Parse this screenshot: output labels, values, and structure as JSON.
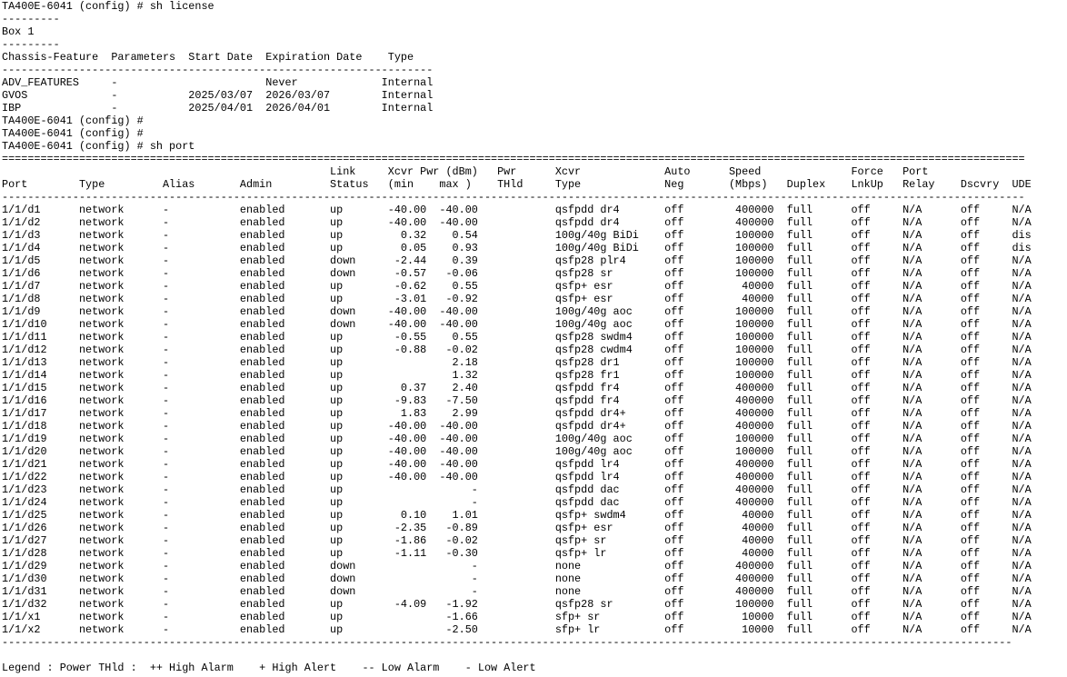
{
  "terminal": {
    "lines": [
      "TA400E-6041 (config) # sh license",
      "---------",
      "Box 1",
      "---------",
      "Chassis-Feature  Parameters  Start Date  Expiration Date    Type",
      "-------------------------------------------------------------------",
      "ADV_FEATURES     -                       Never             Internal",
      "GVOS             -           2025/03/07  2026/03/07        Internal",
      "IBP              -           2025/04/01  2026/04/01        Internal",
      "TA400E-6041 (config) #",
      "TA400E-6041 (config) #",
      "TA400E-6041 (config) # sh port",
      "===============================================================================================================================================================",
      "                                                   Link     Xcvr Pwr (dBm)   Pwr      Xcvr             Auto      Speed              Force   Port",
      "Port        Type         Alias       Admin         Status   (min    max )    THld     Type             Neg       (Mbps)   Duplex    LnkUp   Relay    Dscvry  UDE",
      "---------------------------------------------------------------------------------------------------------------------------------------------------------------",
      "1/1/d1      network      -           enabled       up       -40.00  -40.00            qsfpdd dr4       off        400000  full      off     N/A      off     N/A",
      "1/1/d2      network      -           enabled       up       -40.00  -40.00            qsfpdd dr4       off        400000  full      off     N/A      off     N/A",
      "1/1/d3      network      -           enabled       up         0.32    0.54            100g/40g BiDi    off        100000  full      off     N/A      off     dis",
      "1/1/d4      network      -           enabled       up         0.05    0.93            100g/40g BiDi    off        100000  full      off     N/A      off     dis",
      "1/1/d5      network      -           enabled       down      -2.44    0.39            qsfp28 plr4      off        100000  full      off     N/A      off     N/A",
      "1/1/d6      network      -           enabled       down      -0.57   -0.06            qsfp28 sr        off        100000  full      off     N/A      off     N/A",
      "1/1/d7      network      -           enabled       up        -0.62    0.55            qsfp+ esr        off         40000  full      off     N/A      off     N/A",
      "1/1/d8      network      -           enabled       up        -3.01   -0.92            qsfp+ esr        off         40000  full      off     N/A      off     N/A",
      "1/1/d9      network      -           enabled       down     -40.00  -40.00            100g/40g aoc     off        100000  full      off     N/A      off     N/A",
      "1/1/d10     network      -           enabled       down     -40.00  -40.00            100g/40g aoc     off        100000  full      off     N/A      off     N/A",
      "1/1/d11     network      -           enabled       up        -0.55    0.55            qsfp28 swdm4     off        100000  full      off     N/A      off     N/A",
      "1/1/d12     network      -           enabled       up        -0.88   -0.02            qsfp28 cwdm4     off        100000  full      off     N/A      off     N/A",
      "1/1/d13     network      -           enabled       up                 2.18            qsfp28 dr1       off        100000  full      off     N/A      off     N/A",
      "1/1/d14     network      -           enabled       up                 1.32            qsfp28 fr1       off        100000  full      off     N/A      off     N/A",
      "1/1/d15     network      -           enabled       up         0.37    2.40            qsfpdd fr4       off        400000  full      off     N/A      off     N/A",
      "1/1/d16     network      -           enabled       up        -9.83   -7.50            qsfpdd fr4       off        400000  full      off     N/A      off     N/A",
      "1/1/d17     network      -           enabled       up         1.83    2.99            qsfpdd dr4+      off        400000  full      off     N/A      off     N/A",
      "1/1/d18     network      -           enabled       up       -40.00  -40.00            qsfpdd dr4+      off        400000  full      off     N/A      off     N/A",
      "1/1/d19     network      -           enabled       up       -40.00  -40.00            100g/40g aoc     off        100000  full      off     N/A      off     N/A",
      "1/1/d20     network      -           enabled       up       -40.00  -40.00            100g/40g aoc     off        100000  full      off     N/A      off     N/A",
      "1/1/d21     network      -           enabled       up       -40.00  -40.00            qsfpdd lr4       off        400000  full      off     N/A      off     N/A",
      "1/1/d22     network      -           enabled       up       -40.00  -40.00            qsfpdd lr4       off        400000  full      off     N/A      off     N/A",
      "1/1/d23     network      -           enabled       up                    -            qsfpdd dac       off        400000  full      off     N/A      off     N/A",
      "1/1/d24     network      -           enabled       up                    -            qsfpdd dac       off        400000  full      off     N/A      off     N/A",
      "1/1/d25     network      -           enabled       up         0.10    1.01            qsfp+ swdm4      off         40000  full      off     N/A      off     N/A",
      "1/1/d26     network      -           enabled       up        -2.35   -0.89            qsfp+ esr        off         40000  full      off     N/A      off     N/A",
      "1/1/d27     network      -           enabled       up        -1.86   -0.02            qsfp+ sr         off         40000  full      off     N/A      off     N/A",
      "1/1/d28     network      -           enabled       up        -1.11   -0.30            qsfp+ lr         off         40000  full      off     N/A      off     N/A",
      "1/1/d29     network      -           enabled       down                  -            none             off        400000  full      off     N/A      off     N/A",
      "1/1/d30     network      -           enabled       down                  -            none             off        400000  full      off     N/A      off     N/A",
      "1/1/d31     network      -           enabled       down                  -            none             off        400000  full      off     N/A      off     N/A",
      "1/1/d32     network      -           enabled       up        -4.09   -1.92            qsfp28 sr        off        100000  full      off     N/A      off     N/A",
      "1/1/x1      network      -           enabled       up                -1.66            sfp+ sr          off         10000  full      off     N/A      off     N/A",
      "1/1/x2      network      -           enabled       up                -2.50            sfp+ lr          off         10000  full      off     N/A      off     N/A",
      "-------------------------------------------------------------------------------------------------------------------------------------------------------------",
      "",
      "Legend : Power THld :  ++ High Alarm    + High Alert    -- Low Alarm    - Low Alert"
    ]
  }
}
